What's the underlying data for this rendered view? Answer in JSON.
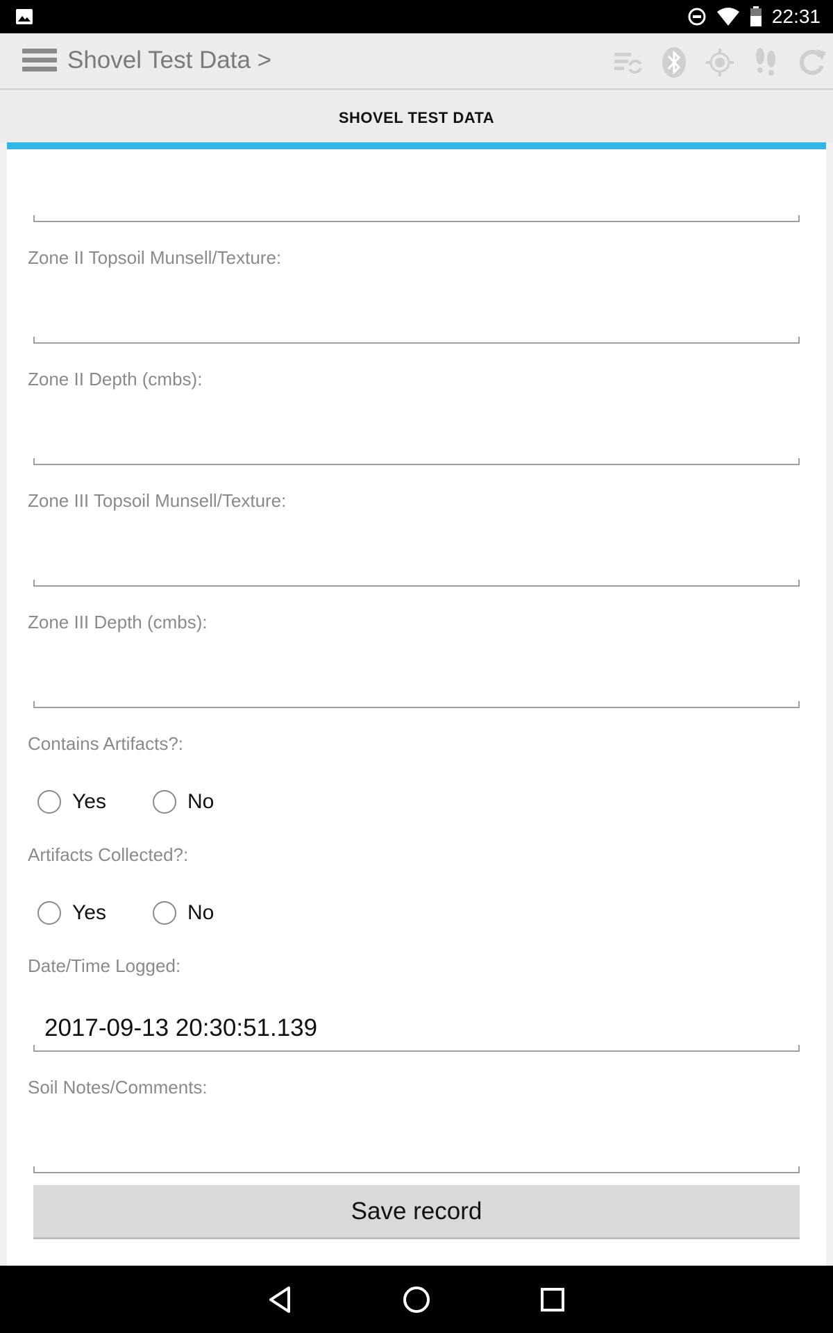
{
  "status_bar": {
    "time": "22:31",
    "icons": [
      "picture-icon",
      "do-not-disturb-icon",
      "wifi-icon",
      "battery-icon"
    ]
  },
  "app_bar": {
    "title": "Shovel Test Data >",
    "actions": [
      "sync-list-icon",
      "bluetooth-icon",
      "gps-icon",
      "footsteps-icon",
      "refresh-icon"
    ]
  },
  "tab": {
    "label": "SHOVEL TEST DATA",
    "indicator_color": "#33b5e5"
  },
  "form": {
    "top_field_value": "",
    "zone2_topsoil": {
      "label": "Zone II Topsoil Munsell/Texture:",
      "value": ""
    },
    "zone2_depth": {
      "label": "Zone II Depth (cmbs):",
      "value": ""
    },
    "zone3_topsoil": {
      "label": "Zone III Topsoil Munsell/Texture:",
      "value": ""
    },
    "zone3_depth": {
      "label": "Zone III Depth (cmbs):",
      "value": ""
    },
    "contains_artifacts": {
      "label": "Contains Artifacts?:",
      "options": [
        "Yes",
        "No"
      ]
    },
    "artifacts_collected": {
      "label": "Artifacts Collected?:",
      "options": [
        "Yes",
        "No"
      ]
    },
    "datetime_logged": {
      "label": "Date/Time Logged:",
      "value": "2017-09-13 20:30:51.139"
    },
    "soil_notes": {
      "label": "Soil Notes/Comments:",
      "value": ""
    },
    "save_label": "Save record"
  },
  "nav": [
    "back-icon",
    "home-icon",
    "recents-icon"
  ]
}
